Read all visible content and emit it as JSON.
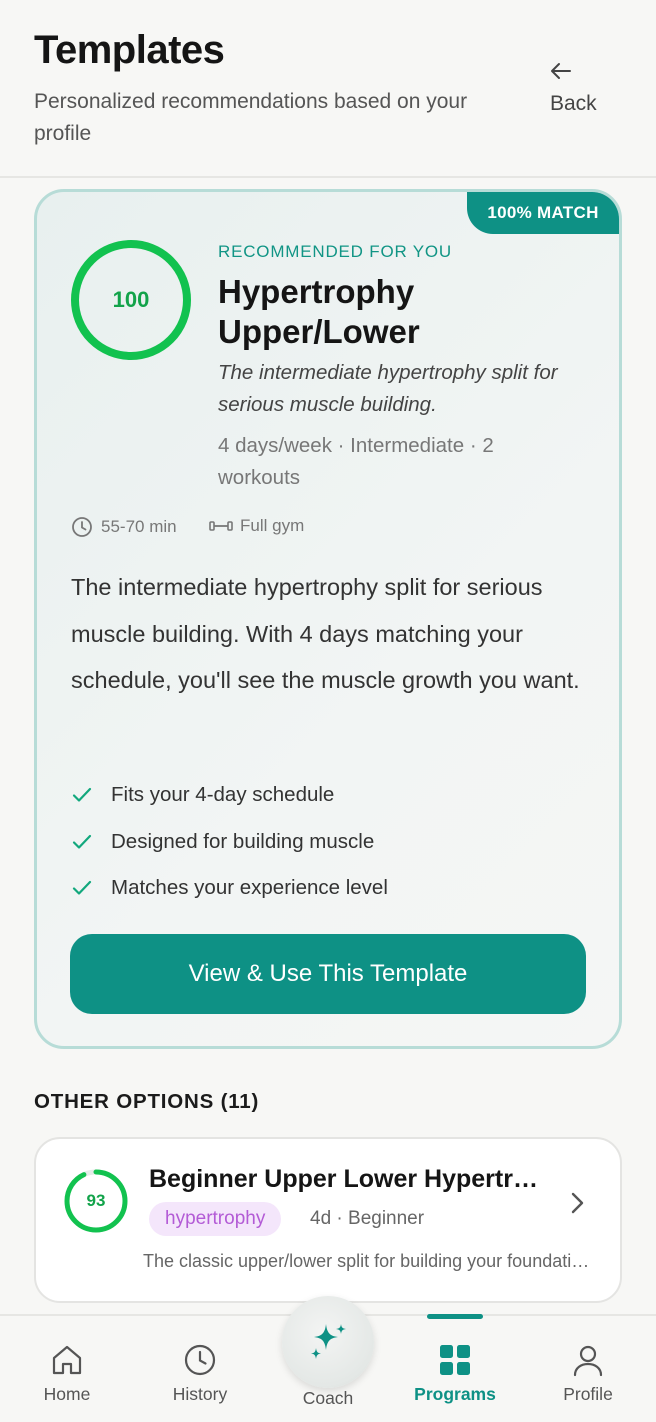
{
  "header": {
    "title": "Templates",
    "subtitle": "Personalized recommendations based on your profile",
    "back_label": "Back",
    "back_icon": "arrow-left-icon"
  },
  "recommended": {
    "badge": "100% MATCH",
    "score": "100",
    "score_fraction": 1.0,
    "label": "RECOMMENDED FOR YOU",
    "name": "Hypertrophy Upper/Lower",
    "tagline": "The intermediate hypertrophy split for serious muscle building.",
    "meta": "4 days/week · Intermediate · 2 workouts",
    "duration": "55-70 min",
    "equipment": "Full gym",
    "description": "The intermediate hypertrophy split for serious muscle building. With 4 days matching your schedule, you'll see the muscle growth you want.",
    "benefits": [
      "Fits your 4-day schedule",
      "Designed for building muscle",
      "Matches your experience level"
    ],
    "cta_label": "View & Use This Template"
  },
  "other": {
    "title": "OTHER OPTIONS (11)",
    "items": [
      {
        "score": "93",
        "score_fraction": 0.93,
        "name": "Beginner Upper Lower Hypertrophy",
        "tag": "hypertrophy",
        "meta": "4d · Beginner",
        "description": "The classic upper/lower split for building your foundation"
      }
    ]
  },
  "nav": {
    "items": [
      {
        "label": "Home",
        "icon": "home-icon"
      },
      {
        "label": "History",
        "icon": "clock-icon"
      },
      {
        "label": "Coach",
        "icon": "sparkle-icon"
      },
      {
        "label": "Programs",
        "icon": "grid-icon"
      },
      {
        "label": "Profile",
        "icon": "person-icon"
      }
    ],
    "active": "Programs"
  },
  "colors": {
    "accent": "#0e9185",
    "score_green": "#12a34a",
    "tag_bg": "#f4e6fb",
    "tag_text": "#b35bd6"
  }
}
